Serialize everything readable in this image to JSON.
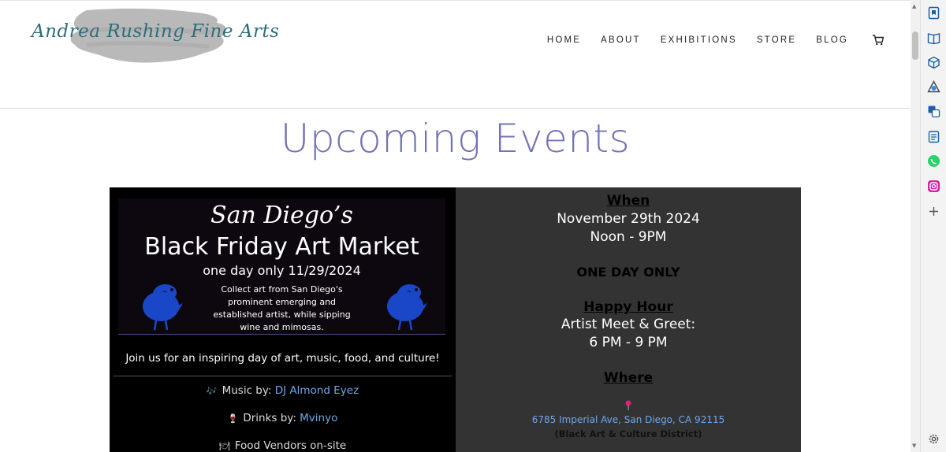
{
  "header": {
    "logo_text": "Andrea Rushing Fine Arts",
    "nav": [
      "HOME",
      "ABOUT",
      "EXHIBITIONS",
      "STORE",
      "BLOG"
    ]
  },
  "page_title": "Upcoming Events",
  "poster": {
    "city": "San Diego’s",
    "title": "Black Friday Art Market",
    "date": "one day only 11/29/2024",
    "desc_lines": [
      "Collect art from San Diego's",
      "prominent emerging and",
      "established artist, while sipping",
      "wine and mimosas."
    ]
  },
  "event_left": {
    "join": "Join us for an inspiring day of art, music, food, and culture!",
    "music_label": "Music by: ",
    "music_link": "DJ Almond Eyez",
    "drinks_label": "Drinks by: ",
    "drinks_link": "Mvinyo",
    "food": "Food Vendors on-site"
  },
  "event_right": {
    "when_heading": "When",
    "when_date": "November 29th 2024",
    "when_time": "Noon - 9PM",
    "one_day": "ONE DAY ONLY",
    "happy_heading": "Happy Hour",
    "happy_text": "Artist Meet & Greet:",
    "happy_time": "6 PM - 9 PM",
    "where_heading": "Where",
    "address": "6785 Imperial Ave, San Diego, CA 92115",
    "district": "(Black Art & Culture District)"
  },
  "colors": {
    "title": "#7273b7",
    "link": "#6fa7ea",
    "logo": "#2e6e7a",
    "bird": "#1a47c8",
    "right_panel": "#333333"
  }
}
